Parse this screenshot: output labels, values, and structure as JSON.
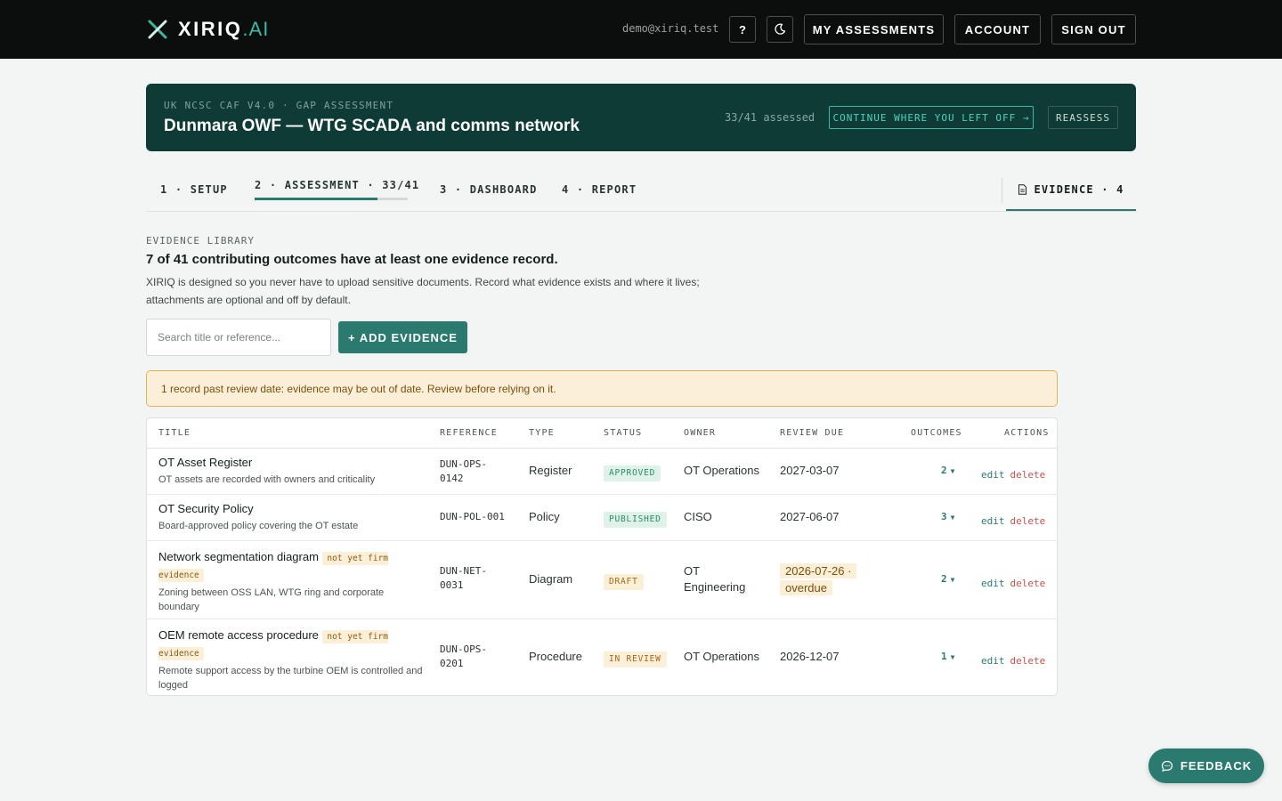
{
  "header": {
    "brand_name": "XIRIQ",
    "brand_suffix": ".AI",
    "user_email": "demo@xiriq.test",
    "help_label": "?",
    "nav": {
      "my_assessments": "MY ASSESSMENTS",
      "account": "ACCOUNT",
      "sign_out": "SIGN OUT"
    }
  },
  "banner": {
    "kicker": "UK NCSC CAF V4.0 · GAP ASSESSMENT",
    "title": "Dunmara OWF — WTG SCADA and comms network",
    "progress_text": "33/41 assessed",
    "continue_label": "CONTINUE WHERE YOU LEFT OFF →",
    "reassess_label": "REASSESS"
  },
  "steps": [
    {
      "label": "1 · SETUP"
    },
    {
      "label": "2 · ASSESSMENT · 33/41",
      "progress": 0.805
    },
    {
      "label": "3 · DASHBOARD"
    },
    {
      "label": "4 · REPORT"
    }
  ],
  "evidence_tab": {
    "label": "EVIDENCE · 4"
  },
  "library": {
    "kicker": "EVIDENCE LIBRARY",
    "title": "7 of 41 contributing outcomes have at least one evidence record.",
    "description": "XIRIQ is designed so you never have to upload sensitive documents. Record what evidence exists and where it lives; attachments are optional and off by default.",
    "search_placeholder": "Search title or reference...",
    "add_label": "+ ADD EVIDENCE",
    "warning": "1 record past review date: evidence may be out of date. Review before relying on it."
  },
  "table": {
    "headers": {
      "title": "TITLE",
      "reference": "REFERENCE",
      "type": "TYPE",
      "status": "STATUS",
      "owner": "OWNER",
      "review_due": "REVIEW DUE",
      "outcomes": "OUTCOMES",
      "actions": "ACTIONS"
    },
    "edit_label": "edit",
    "delete_label": "delete",
    "rows": [
      {
        "title": "OT Asset Register",
        "subtitle": "OT assets are recorded with owners and criticality",
        "reference": "DUN-OPS-0142",
        "type": "Register",
        "status": "APPROVED",
        "owner": "OT Operations",
        "review_due": "2027-03-07",
        "outcomes": "2"
      },
      {
        "title": "OT Security Policy",
        "subtitle": "Board-approved policy covering the OT estate",
        "reference": "DUN-POL-001",
        "type": "Policy",
        "status": "PUBLISHED",
        "owner": "CISO",
        "review_due": "2027-06-07",
        "outcomes": "3"
      },
      {
        "title": "Network segmentation diagram",
        "tag": "not yet firm evidence",
        "subtitle": "Zoning between OSS LAN, WTG ring and corporate boundary",
        "reference": "DUN-NET-0031",
        "type": "Diagram",
        "status": "DRAFT",
        "owner": "OT Engineering",
        "review_due": "2026-07-26 · overdue",
        "outcomes": "2"
      },
      {
        "title": "OEM remote access procedure",
        "tag": "not yet firm evidence",
        "subtitle": "Remote support access by the turbine OEM is controlled and logged",
        "reference": "DUN-OPS-0201",
        "type": "Procedure",
        "status": "IN REVIEW",
        "owner": "OT Operations",
        "review_due": "2026-12-07",
        "outcomes": "1"
      }
    ]
  },
  "feedback_label": "FEEDBACK",
  "colors": {
    "topbar": "#0c0d0d",
    "banner": "#0f3b36",
    "accent": "#2b7a70",
    "warning_bg": "#fcefd8",
    "warning_border": "#e3b15a",
    "delete": "#c2534c"
  },
  "icons": {
    "logo": "x-logo-icon",
    "theme": "moon-icon",
    "evidence": "document-icon",
    "feedback": "chat-bubble-icon"
  }
}
